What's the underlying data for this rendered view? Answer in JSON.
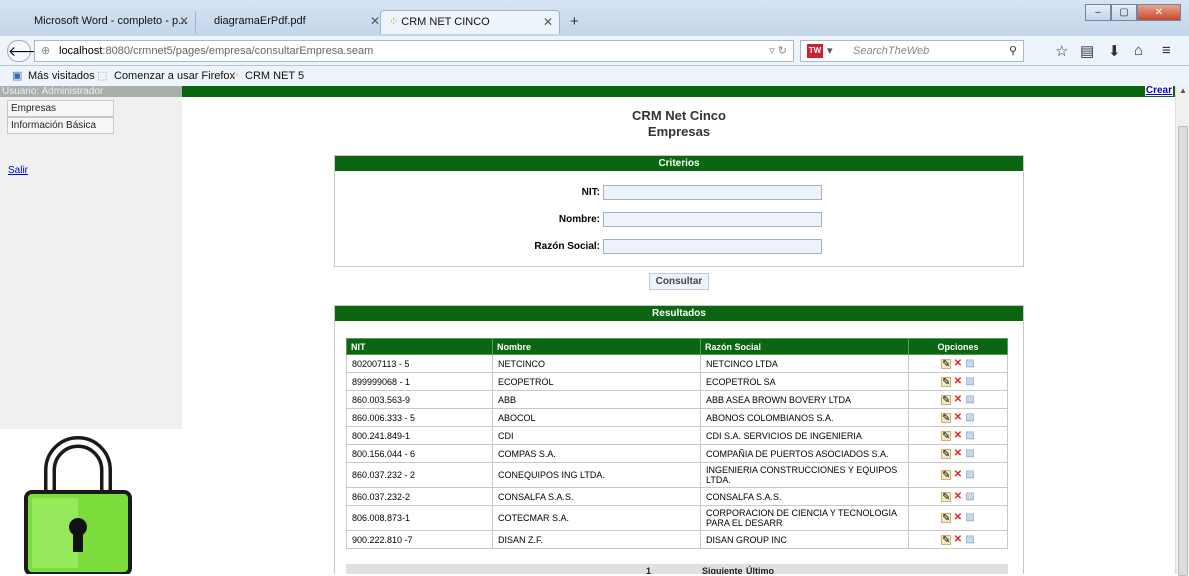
{
  "browser": {
    "tabs": [
      {
        "title": "Microsoft Word - completo - p..."
      },
      {
        "title": "diagramaErPdf.pdf"
      },
      {
        "title": "CRM NET CINCO"
      }
    ],
    "new_tab": "+",
    "url_host": "localhost",
    "url_rest": ":8080/crmnet5/pages/empresa/consultarEmpresa.seam",
    "search_placeholder": "SearchTheWeb",
    "bookmarks": [
      "Más visitados",
      "Comenzar a usar Firefox",
      "CRM NET 5"
    ]
  },
  "page": {
    "user_label": "Usuario: Administrador",
    "crear_link": "Crear",
    "sidebar": {
      "items": [
        "Empresas",
        "Información Básica"
      ],
      "logout": "Salir"
    },
    "title": "CRM Net Cinco",
    "subtitle": "Empresas",
    "criteria": {
      "header": "Criterios",
      "fields": [
        {
          "label": "NIT:",
          "value": ""
        },
        {
          "label": "Nombre:",
          "value": ""
        },
        {
          "label": "Razón Social:",
          "value": ""
        }
      ]
    },
    "consultar": "Consultar",
    "results": {
      "header": "Resultados",
      "columns": [
        "NIT",
        "Nombre",
        "Razón Social",
        "Opciones"
      ],
      "rows": [
        [
          "802007113 - 5",
          "NETCINCO",
          "NETCINCO LTDA"
        ],
        [
          "899999068 - 1",
          "ECOPETROL",
          "ECOPETROL SA"
        ],
        [
          "860.003.563-9",
          "ABB",
          "ABB ASEA BROWN BOVERY LTDA"
        ],
        [
          "860.006.333 - 5",
          "ABOCOL",
          "ABONOS COLOMBIANOS S.A."
        ],
        [
          "800.241.849-1",
          "CDI",
          "CDI S.A. SERVICIOS DE INGENIERIA"
        ],
        [
          "800.156.044 - 6",
          "COMPAS S.A.",
          "COMPAÑIA DE PUERTOS ASOCIADOS S.A."
        ],
        [
          "860.037.232 - 2",
          "CONEQUIPOS ING LTDA.",
          "INGENIERIA CONSTRUCCIONES Y EQUIPOS LTDA."
        ],
        [
          "860.037.232-2",
          "CONSALFA S.A.S.",
          "CONSALFA S.A.S."
        ],
        [
          "806.008.873-1",
          "COTECMAR S.A.",
          "CORPORACION DE CIENCIA Y TECNOLOGIA PARA EL DESARR"
        ],
        [
          "900.222.810 -7",
          "DISAN Z.F.",
          "DISAN GROUP INC"
        ]
      ],
      "pager": {
        "current": "1",
        "next": "Siguiente",
        "last": "Último"
      }
    }
  }
}
